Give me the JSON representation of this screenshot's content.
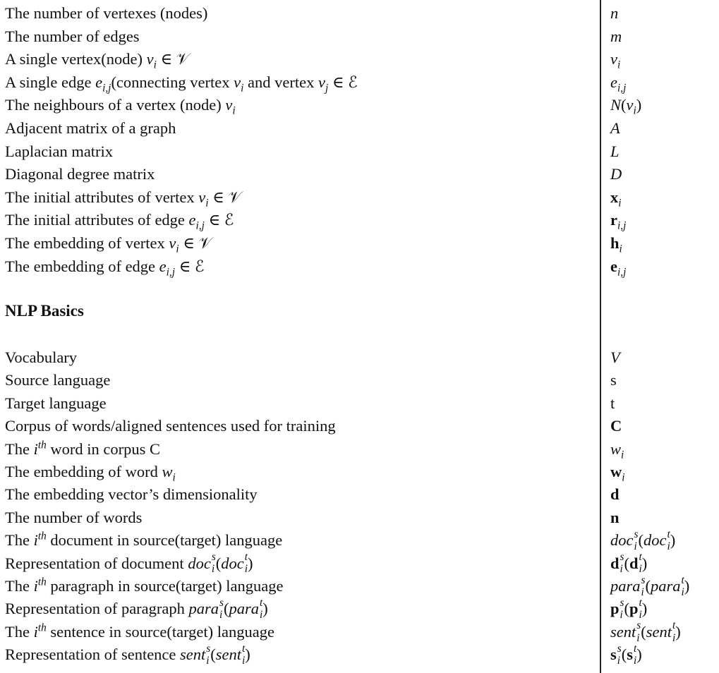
{
  "graph_rows": [
    {
      "desc": "The number of vertexes (nodes)",
      "sym": "n"
    },
    {
      "desc": "The number of edges",
      "sym": "m"
    },
    {
      "desc": "A single vertex(node) v_i ∈ 𝒱",
      "sym": "v_i"
    },
    {
      "desc": "A single edge e_{i,j}(connecting vertex v_i and vertex v_j ∈ ℰ",
      "sym": "e_{i,j}"
    },
    {
      "desc": "The neighbours of a vertex (node) v_i",
      "sym": "N(v_i)"
    },
    {
      "desc": "Adjacent matrix of a graph",
      "sym": "A"
    },
    {
      "desc": "Laplacian matrix",
      "sym": "L"
    },
    {
      "desc": "Diagonal degree matrix",
      "sym": "D"
    },
    {
      "desc": "The initial attributes of vertex v_i ∈ 𝒱",
      "sym": "x_i"
    },
    {
      "desc": "The initial attributes of edge e_{i,j} ∈ ℰ",
      "sym": "r_{i,j}"
    },
    {
      "desc": "The embedding of vertex v_i ∈ 𝒱",
      "sym": "h_i"
    },
    {
      "desc": "The embedding of edge e_{i,j} ∈ ℰ",
      "sym": "e_{i,j}"
    }
  ],
  "section_heading": "NLP Basics",
  "nlp_rows": [
    {
      "desc": "Vocabulary",
      "sym": "V"
    },
    {
      "desc": "Source language",
      "sym": "s"
    },
    {
      "desc": "Target language",
      "sym": "t"
    },
    {
      "desc": "Corpus of words/aligned sentences used for training",
      "sym": "C"
    },
    {
      "desc": "The i^{th} word in corpus C",
      "sym": "w_i"
    },
    {
      "desc": "The embedding of word w_i",
      "sym": "w_i"
    },
    {
      "desc": "The embedding vector’s dimensionality",
      "sym": "d"
    },
    {
      "desc": "The number of words",
      "sym": "n"
    },
    {
      "desc": "The i^{th} document in source(target) language",
      "sym": "doc_i^s(doc_i^t)"
    },
    {
      "desc": "Representation of document doc_i^s(doc_i^t)",
      "sym": "d_i^s(d_i^t)"
    },
    {
      "desc": "The i^{th} paragraph in source(target) language",
      "sym": "para_i^s(para_i^t)"
    },
    {
      "desc": "Representation of paragraph para_i^s(para_i^t)",
      "sym": "p_i^s(p_i^t)"
    },
    {
      "desc": "The i^{th} sentence in source(target) language",
      "sym": "sent_i^s(sent_i^t)"
    },
    {
      "desc": "Representation of sentence sent_i^s(sent_i^t)",
      "sym": "s_i^s(s_i^t)"
    }
  ]
}
